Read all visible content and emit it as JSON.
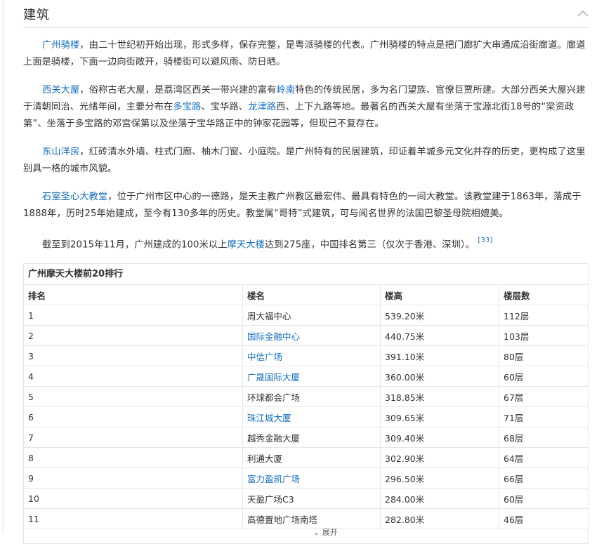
{
  "section": {
    "title": "建筑",
    "collapse_icon": "chevron-up-icon"
  },
  "paragraphs": [
    {
      "segments": [
        {
          "text": "广州骑楼",
          "link": true
        },
        {
          "text": "，由二十世纪初开始出现，形式多样，保存完整，是粤派骑楼的代表。广州骑楼的特点是把门廊扩大串通成沿街廊道。廊道上面是骑楼，下面一边向街敞开，骑楼街可以避风雨、防日晒。",
          "link": false
        }
      ]
    },
    {
      "segments": [
        {
          "text": "西关大屋",
          "link": true
        },
        {
          "text": "，俗称古老大屋，是荔湾区西关一带兴建的富有",
          "link": false
        },
        {
          "text": "岭南",
          "link": true
        },
        {
          "text": "特色的传统民居，多为名门望族、官僚巨贾所建。大部分西关大屋兴建于清朝同治、光绪年间，主要分布在",
          "link": false
        },
        {
          "text": "多宝路",
          "link": true
        },
        {
          "text": "、宝华路、",
          "link": false
        },
        {
          "text": "龙津路",
          "link": true
        },
        {
          "text": "西、上下九路等地。最著名的西关大屋有坐落于宝源北街18号的“梁资政第”、坐落于多宝路的邓宫保第以及坐落于宝华路正中的钟家花园等，但现已不复存在。",
          "link": false
        }
      ]
    },
    {
      "segments": [
        {
          "text": "东山洋房",
          "link": true
        },
        {
          "text": "，红砖清水外墙、柱式门廊、柚木门窗、小庭院。是广州特有的民居建筑，印证着羊城多元文化并存的历史，更构成了这里别具一格的城市风貌。",
          "link": false
        }
      ]
    },
    {
      "segments": [
        {
          "text": "石室圣心大教堂",
          "link": true
        },
        {
          "text": "，位于广州市区中心的一德路，是天主教广州教区最宏伟、最具有特色的一间大教堂。该教堂建于1863年，落成于1888年，历时25年始建成，至今有130多年的历史。教堂属“哥特”式建筑，可与闻名世界的法国巴黎圣母院相媲美。",
          "link": false
        }
      ]
    },
    {
      "segments": [
        {
          "text": "截至到2015年11月，广州建成的100米以上",
          "link": false
        },
        {
          "text": "摩天大楼",
          "link": true
        },
        {
          "text": "达到275座，中国排名第三（仅次于香港、深圳）。",
          "link": false
        }
      ],
      "ref": "[33]"
    }
  ],
  "table": {
    "title": "广州摩天大楼前20排行",
    "headers": [
      "排名",
      "楼名",
      "楼高",
      "楼层数"
    ],
    "rows": [
      {
        "rank": "1",
        "name": "周大福中心",
        "height": "539.20米",
        "floors": "112层",
        "link": false
      },
      {
        "rank": "2",
        "name": "国际金融中心",
        "height": "440.75米",
        "floors": "103层",
        "link": true
      },
      {
        "rank": "3",
        "name": "中信广场",
        "height": "391.10米",
        "floors": "80层",
        "link": true
      },
      {
        "rank": "4",
        "name": "广晟国际大厦",
        "height": "360.00米",
        "floors": "60层",
        "link": true
      },
      {
        "rank": "5",
        "name": "环球都会广场",
        "height": "318.85米",
        "floors": "67层",
        "link": false
      },
      {
        "rank": "6",
        "name": "珠江城大厦",
        "height": "309.65米",
        "floors": "71层",
        "link": true
      },
      {
        "rank": "7",
        "name": "越秀金融大厦",
        "height": "309.40米",
        "floors": "68层",
        "link": false
      },
      {
        "rank": "8",
        "name": "利通大厦",
        "height": "302.90米",
        "floors": "64层",
        "link": false
      },
      {
        "rank": "9",
        "name": "富力盈凯广场",
        "height": "296.50米",
        "floors": "66层",
        "link": true
      },
      {
        "rank": "10",
        "name": "天盈广场C3",
        "height": "284.00米",
        "floors": "60层",
        "link": false
      },
      {
        "rank": "11",
        "name": "高德置地广场南塔",
        "height": "282.80米",
        "floors": "46层",
        "link": false
      }
    ],
    "expand_label": "展开",
    "expand_icon": "chevron-down-icon"
  }
}
